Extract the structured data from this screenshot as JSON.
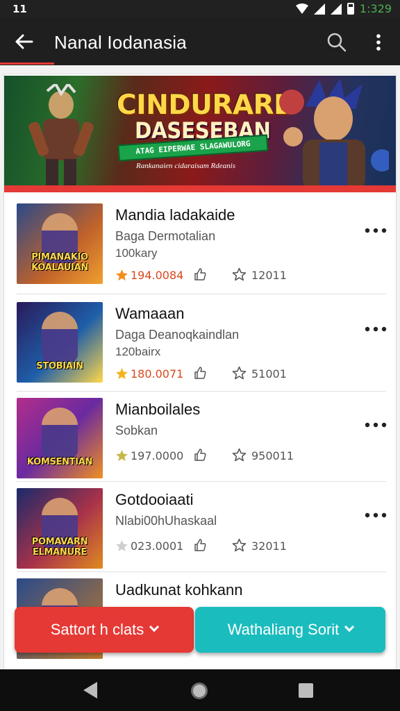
{
  "status_bar": {
    "left": "11",
    "time": "1:329"
  },
  "app_bar": {
    "title": "Nanal Iodanasia"
  },
  "banner": {
    "title_line1": "CINDURARD",
    "title_line2": "DASESEBAN",
    "ribbon": "ATAG EIPERWAE SLAGAWULORG",
    "subtitle": "Rankanaien cidaraisam Rdeanis"
  },
  "items": [
    {
      "title": "Mandia ladakaide",
      "subtitle": "Baga Dermotalian",
      "size": "100kary",
      "rating": "194.0084",
      "star_color": "#f28c1a",
      "rating_color": "#d9481c",
      "favorites": "12011",
      "thumb_label": "PIMANAKIO KOALAUIAN",
      "thumb_bg": "linear-gradient(135deg,#2a4a8a,#c0622a 60%,#f0a030)"
    },
    {
      "title": "Wamaaan",
      "subtitle": "Daga Deanoqkaindlan",
      "size": "120bairx",
      "rating": "180.0071",
      "star_color": "#f3b31c",
      "rating_color": "#d9481c",
      "favorites": "51001",
      "thumb_label": "STOBIAIN",
      "thumb_bg": "linear-gradient(135deg,#2a1a5a,#1e5ea8 55%,#ffd84a)"
    },
    {
      "title": "Mianboilales",
      "subtitle": "Sobkan",
      "size": "",
      "rating": "197.0000",
      "star_color": "#c7b84a",
      "rating_color": "#555555",
      "favorites": "950011",
      "thumb_label": "KOMSENTIAN",
      "thumb_bg": "linear-gradient(135deg,#b22e8a,#6a2aa0 50%,#f09020)"
    },
    {
      "title": "Gotdooiaati",
      "subtitle": "Nlabi00hUhaskaal",
      "size": "",
      "rating": "023.0001",
      "star_color": "#cfcfcf",
      "rating_color": "#555555",
      "favorites": "32011",
      "thumb_label": "POMAVARN ELMANURE",
      "thumb_bg": "linear-gradient(135deg,#1a2a6a,#a8324a 55%,#e08a20)"
    },
    {
      "title": "Uadkunat kohkann",
      "subtitle": "",
      "size": "",
      "rating": "",
      "favorites": "",
      "thumb_label": "",
      "thumb_bg": "linear-gradient(135deg,#2a4a8a,#c07a2a)"
    }
  ],
  "buttons": {
    "left": "Sattort h clats",
    "right": "Wathaliang Sorit"
  },
  "colors": {
    "accent_red": "#e53935",
    "accent_teal": "#1bbcbd"
  }
}
